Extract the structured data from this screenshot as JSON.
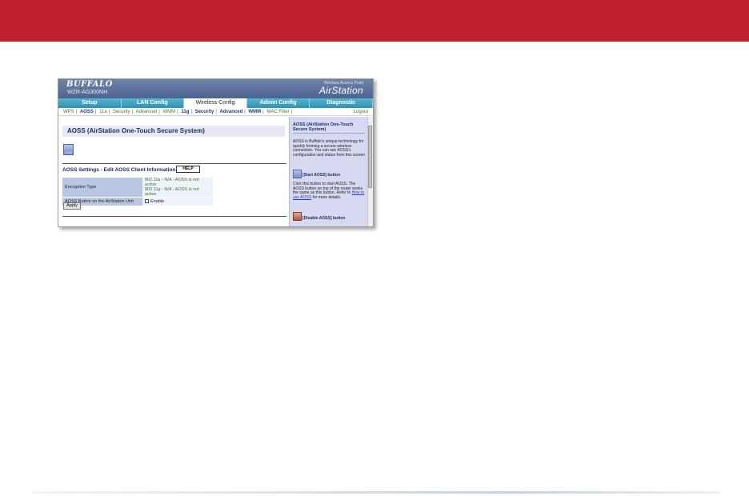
{
  "header": {
    "brand": "BUFFALO",
    "model": "WZR-AG300NH",
    "product_line": "Wireless Access Point",
    "product_name": "AirStation"
  },
  "tabs": [
    "Setup",
    "LAN Config",
    "Wireless Config",
    "Admin Config",
    "Diagnostic"
  ],
  "active_tab": "Wireless Config",
  "subnav": {
    "items": [
      "WPS",
      "AOSS",
      "11a",
      "Security",
      "Advanced",
      "WMM",
      "11g",
      "Security",
      "Advanced",
      "WMM",
      "MAC Filter"
    ],
    "logout": "Logout"
  },
  "main": {
    "page_title": "AOSS (AirStation One-Touch Secure System)",
    "settings_heading": "AOSS Settings - Edit AOSS Client Information",
    "help_label": "HELP",
    "rows": [
      {
        "label": "Encryption Type",
        "value_line1": "802.11a - N/A - AOSS is not active",
        "value_line2": "802.11g - N/A - AOSS is not active"
      },
      {
        "label": "AOSS Button on the AirStation Unit",
        "value": "Enable"
      }
    ],
    "apply_label": "Apply"
  },
  "side": {
    "title": "AOSS (AirStation One-Touch Secure System)",
    "intro": "AOSS is Buffalo's unique technology for quickly forming a secure wireless connection. You can see AOSS's configuration and status from this screen.",
    "start_label": "[Start AOSS] button",
    "start_text": "Click this button to start AOSS. The AOSS button on top of the router works the same as this button. Refer to",
    "start_link": "How to use AOSS",
    "start_tail": "for more details.",
    "disable_label": "[Disable AOSS] button"
  },
  "colors": {
    "banner": "#c1212f",
    "header_bar": "#4c6490",
    "tab_bar": "#3aa0c0",
    "side_panel": "#d7d9f2"
  }
}
